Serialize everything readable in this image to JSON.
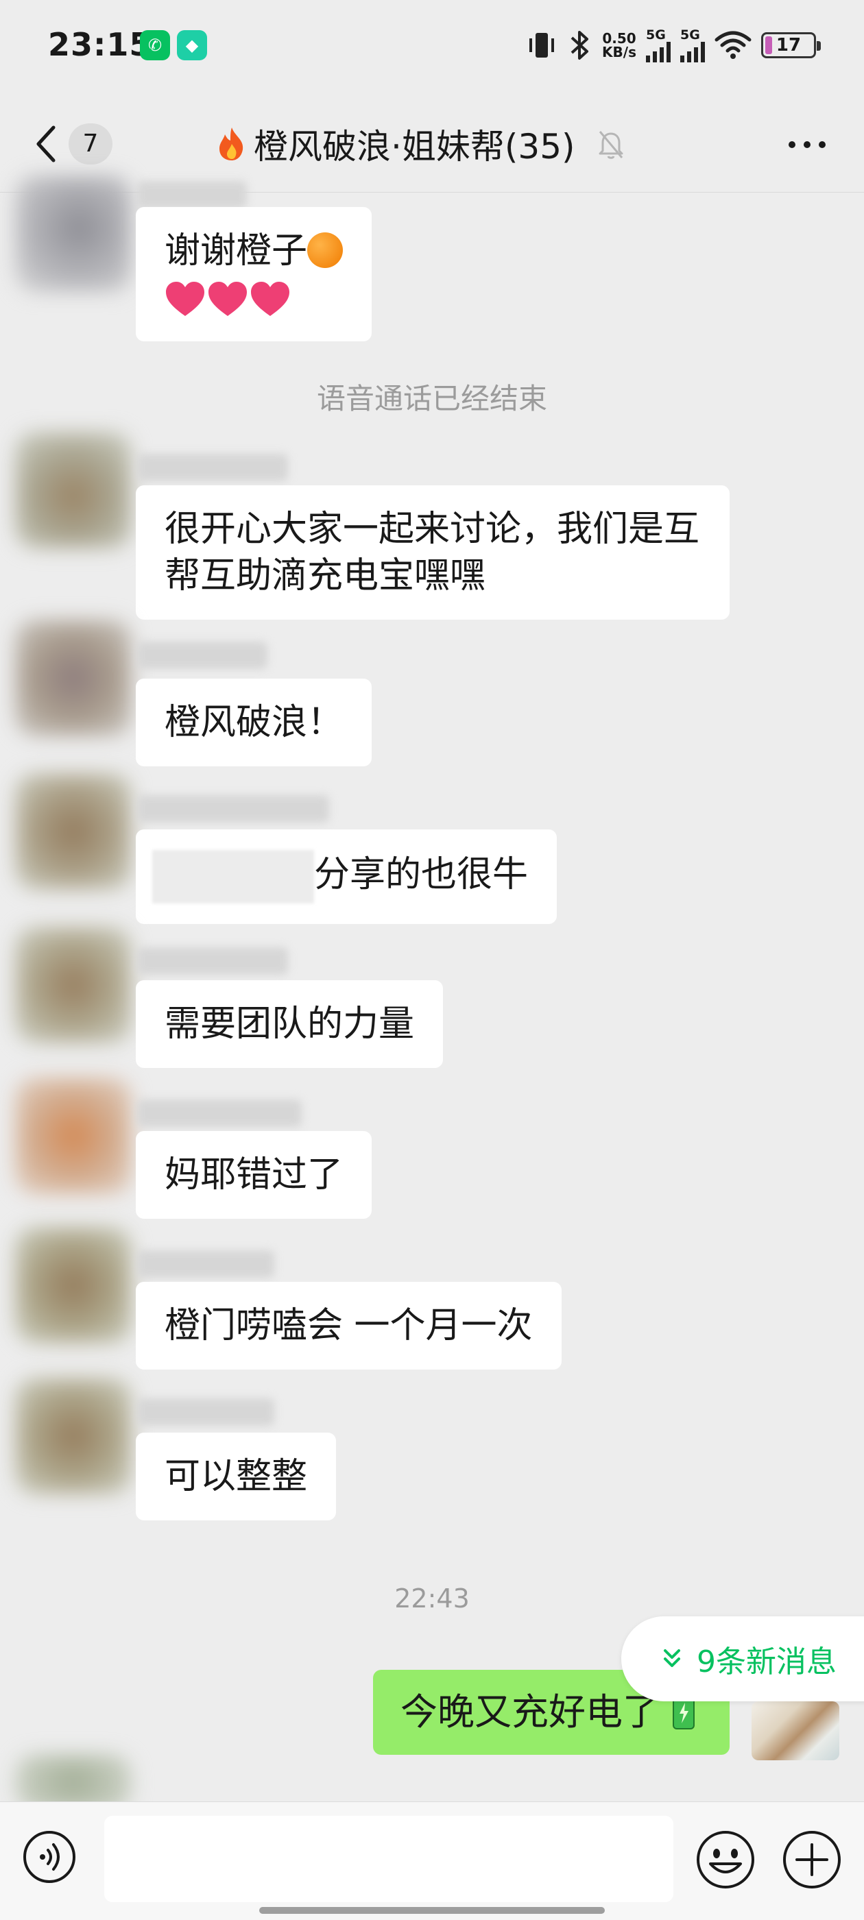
{
  "status_bar": {
    "time": "23:15",
    "net_speed_value": "0.50",
    "net_speed_unit": "KB/s",
    "signal1_label": "5G",
    "signal2_label": "5G",
    "battery": "17",
    "icons": [
      "wechat-icon",
      "shield-app-icon",
      "vibrate-icon",
      "bluetooth-icon",
      "wifi-icon",
      "battery-icon"
    ]
  },
  "header": {
    "unread_count": "7",
    "title": "橙风破浪·姐妹帮(35)",
    "icons": [
      "back-icon",
      "fire-icon",
      "mute-icon",
      "more-icon"
    ]
  },
  "messages": [
    {
      "text": "谢谢橙子",
      "hearts": 3
    },
    {
      "system": "语音通话已经结束"
    },
    {
      "text": "很开心大家一起来讨论，我们是互帮互助滴充电宝嘿嘿"
    },
    {
      "text": "橙风破浪！"
    },
    {
      "text": "分享的也很牛"
    },
    {
      "text": "需要团队的力量"
    },
    {
      "text": "妈耶错过了"
    },
    {
      "text": "橙门唠嗑会 一个月一次"
    },
    {
      "text": "可以整整"
    }
  ],
  "timestamp": "22:43",
  "my_message": "今晚又充好电了",
  "new_messages_label": "9条新消息",
  "input": {
    "value": "",
    "placeholder": ""
  },
  "colors": {
    "background": "#ededed",
    "my_bubble": "#95ec69",
    "accent": "#07c160"
  }
}
